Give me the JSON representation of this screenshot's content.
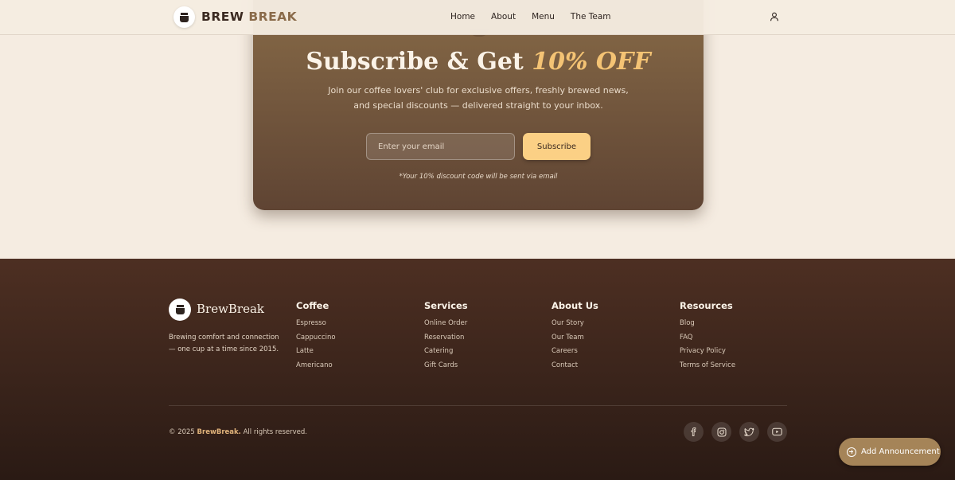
{
  "nav": {
    "brand_part1": "BREW",
    "brand_part2": "BREAK",
    "links": [
      "Home",
      "About",
      "Menu",
      "The Team"
    ],
    "user_icon": "user-icon"
  },
  "subscribe": {
    "title_main": "Subscribe & Get",
    "title_highlight": "10% OFF",
    "text": "Join our coffee lovers' club for exclusive offers, freshly brewed news, and special discounts — delivered straight to your inbox.",
    "email_placeholder": "Enter your email",
    "button_label": "Subscribe",
    "note": "*Your 10% discount code will be sent via email"
  },
  "footer": {
    "brand": "BrewBreak",
    "description": "Brewing comfort and connection — one cup at a time since 2015.",
    "columns": [
      {
        "title": "Coffee",
        "items": [
          "Espresso",
          "Cappuccino",
          "Latte",
          "Americano"
        ]
      },
      {
        "title": "Services",
        "items": [
          "Online Order",
          "Reservation",
          "Catering",
          "Gift Cards"
        ]
      },
      {
        "title": "About Us",
        "items": [
          "Our Story",
          "Our Team",
          "Careers",
          "Contact"
        ]
      },
      {
        "title": "Resources",
        "items": [
          "Blog",
          "FAQ",
          "Privacy Policy",
          "Terms of Service"
        ]
      }
    ],
    "copyright_prefix": "© 2025",
    "copyright_brand": "BrewBreak.",
    "copyright_suffix": "All rights reserved.",
    "social": [
      "facebook-icon",
      "instagram-icon",
      "twitter-icon",
      "youtube-icon"
    ]
  },
  "announcement_button": "Add Announcement",
  "colors": {
    "background": "#f5ece1",
    "accent": "#fbd085",
    "highlight": "#f4c374",
    "footer_bg": "#3a241b",
    "announcement_bg": "#a58458"
  }
}
